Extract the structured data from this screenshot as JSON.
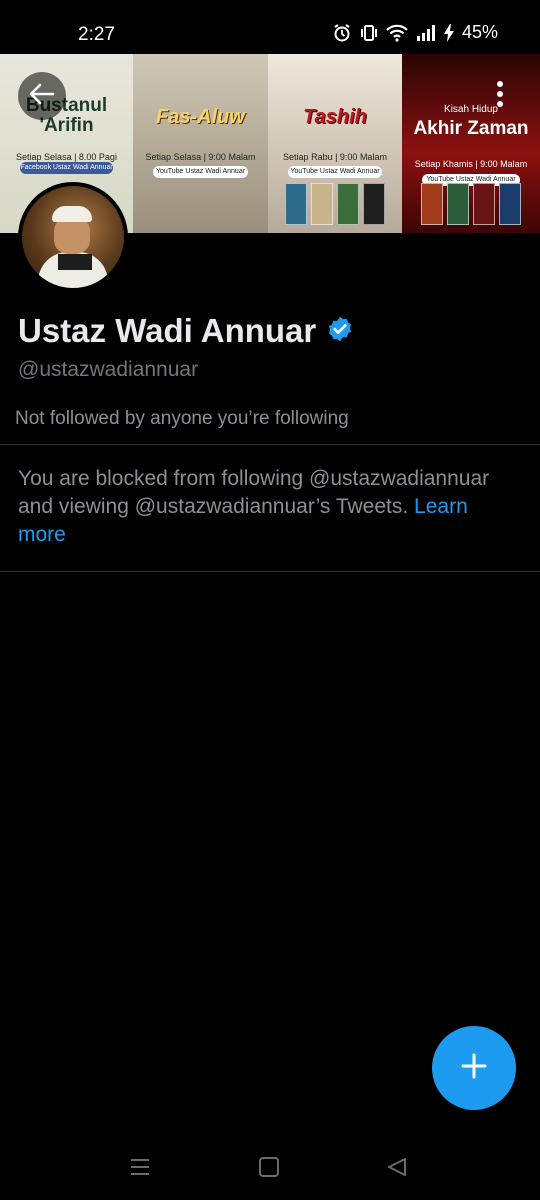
{
  "status_bar": {
    "time": "2:27",
    "battery": "45%",
    "icons": [
      "alarm-icon",
      "vibrate-icon",
      "wifi-icon",
      "signal-icon",
      "charging-icon"
    ]
  },
  "banner": {
    "panels": [
      {
        "lines": [
          "Bustanul",
          "'Arifin"
        ],
        "schedule": "Setiap Selasa | 8.00 Pagi",
        "tag": "Facebook Ustaz Wadi Annuar"
      },
      {
        "title": "Fas-Aluw",
        "schedule": "Setiap Selasa | 9:00 Malam",
        "tag": "YouTube Ustaz Wadi Annuar"
      },
      {
        "title": "Tashih",
        "schedule": "Setiap Rabu | 9:00 Malam",
        "tag": "YouTube Ustaz Wadi Annuar"
      },
      {
        "kicker": "Kisah Hidup",
        "title": "Akhir Zaman",
        "schedule": "Setiap Khamis | 9:00 Malam",
        "tag": "YouTube Ustaz Wadi Annuar"
      }
    ]
  },
  "profile": {
    "name": "Ustaz Wadi Annuar",
    "handle": "@ustazwadiannuar",
    "verified": true,
    "followed_by": "Not followed by anyone you’re following"
  },
  "blocked_notice": {
    "text": "You are blocked from following @ustazwadiannuar and viewing @ustazwadiannuar’s Tweets. ",
    "link": "Learn more"
  },
  "colors": {
    "accent": "#1d9bf0",
    "background": "#000000",
    "secondary_text": "#71767b"
  }
}
